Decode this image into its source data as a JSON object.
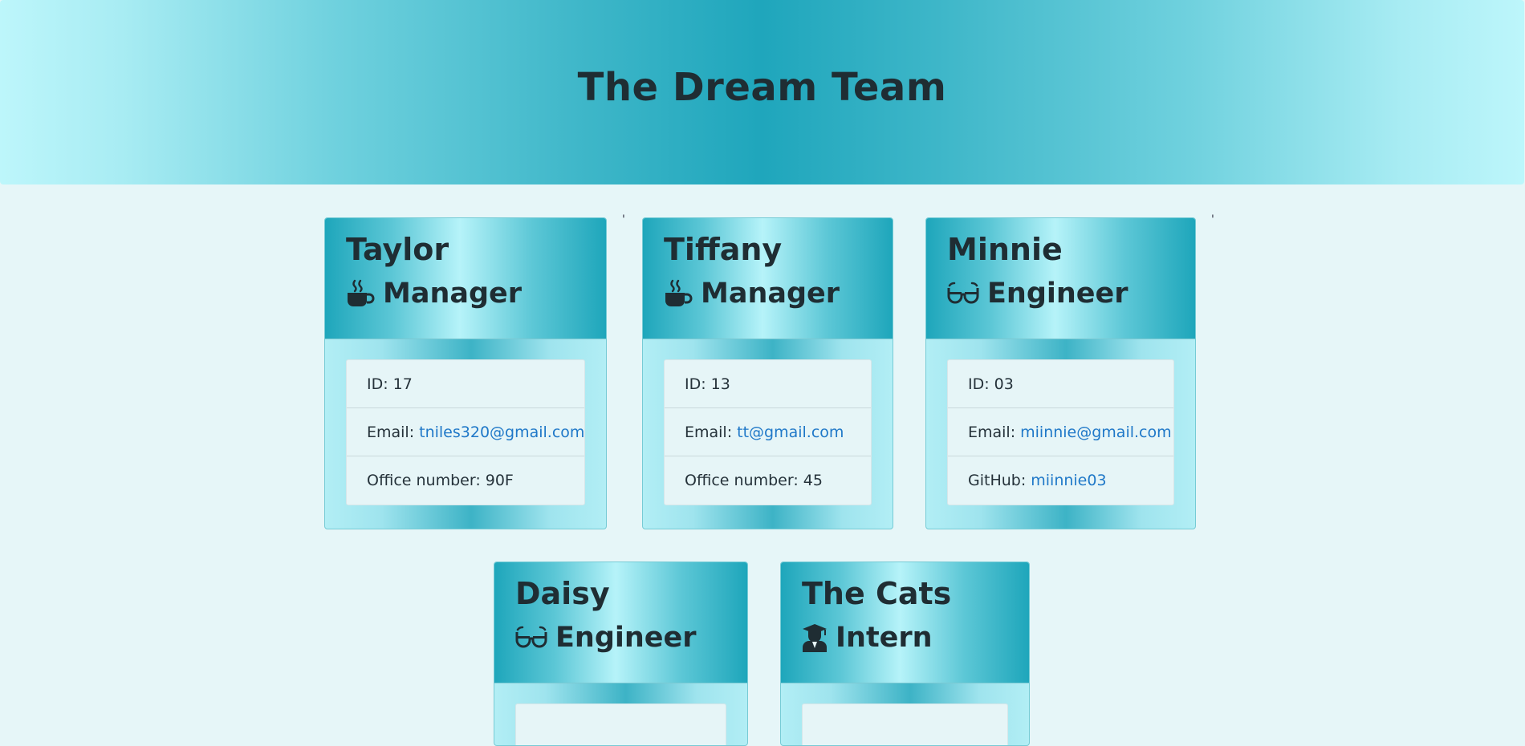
{
  "header": {
    "title": "The Dream Team"
  },
  "stray_marks": [
    "'",
    "'"
  ],
  "cards": [
    {
      "name": "Taylor",
      "role": "Manager",
      "icon": "coffee-icon",
      "id_text": "ID: 17",
      "email_label": "Email:",
      "email": "tniles320@gmail.com",
      "extra_text": "Office number: 90F",
      "extra_label": "",
      "extra_link": ""
    },
    {
      "name": "Tiffany",
      "role": "Manager",
      "icon": "coffee-icon",
      "id_text": "ID: 13",
      "email_label": "Email:",
      "email": "tt@gmail.com",
      "extra_text": "Office number: 45",
      "extra_label": "",
      "extra_link": ""
    },
    {
      "name": "Minnie",
      "role": "Engineer",
      "icon": "glasses-icon",
      "id_text": "ID: 03",
      "email_label": "Email:",
      "email": "miinnie@gmail.com",
      "extra_text": "",
      "extra_label": "GitHub:",
      "extra_link": "miinnie03"
    },
    {
      "name": "Daisy",
      "role": "Engineer",
      "icon": "glasses-icon"
    },
    {
      "name": "The Cats",
      "role": "Intern",
      "icon": "graduate-icon"
    }
  ],
  "colors": {
    "background": "#e6f6f8",
    "header_center": "#1fa6bc",
    "header_edge": "#bdf6fb",
    "link": "#1f78c8",
    "text": "#1f2d33"
  }
}
